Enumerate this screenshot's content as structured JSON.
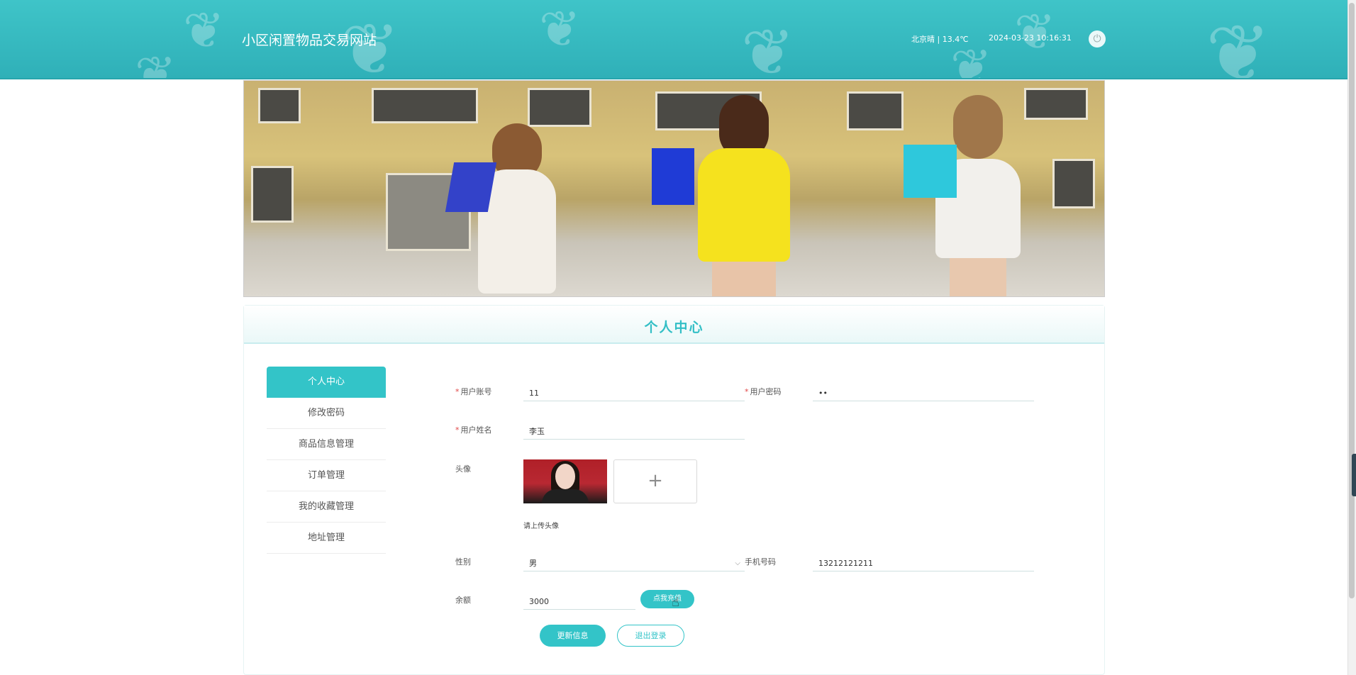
{
  "header": {
    "site_title": "小区闲置物品交易网站",
    "weather": "北京晴 | 13.4℃",
    "datetime": "2024-03-23  10:16:31",
    "power_icon": "power-icon"
  },
  "banner": {
    "image": "banner-shopping-girls-image"
  },
  "panel": {
    "title": "个人中心"
  },
  "sidebar": {
    "items": [
      {
        "label": "个人中心"
      },
      {
        "label": "修改密码"
      },
      {
        "label": "商品信息管理"
      },
      {
        "label": "订单管理"
      },
      {
        "label": "我的收藏管理"
      },
      {
        "label": "地址管理"
      }
    ]
  },
  "form": {
    "account_label": "用户账号",
    "account_value": "11",
    "password_label": "用户密码",
    "password_value": "••",
    "name_label": "用户姓名",
    "name_value": "李玉",
    "avatar_label": "头像",
    "upload_plus": "+",
    "upload_hint": "请上传头像",
    "gender_label": "性别",
    "gender_value": "男",
    "phone_label": "手机号码",
    "phone_value": "13212121211",
    "balance_label": "余额",
    "balance_value": "3000",
    "required_mark": "*"
  },
  "buttons": {
    "recharge": "点我充值",
    "update": "更新信息",
    "logout": "退出登录"
  },
  "colors": {
    "accent": "#33c4c8",
    "header_bg": "#3fc4c8",
    "required": "#e04444"
  }
}
